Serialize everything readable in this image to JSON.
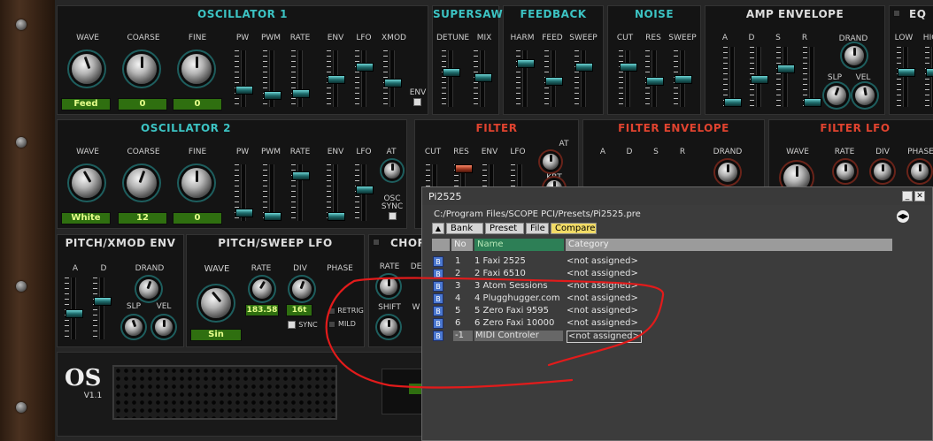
{
  "window": {
    "title": "Pi2525",
    "path": "C:/Program Files/SCOPE PCI/Presets/Pi2525.pre",
    "minimize_label": "_",
    "close_label": "✕",
    "nav_icon": "◀▶"
  },
  "tabs": [
    {
      "label": "Bank"
    },
    {
      "label": "Preset"
    },
    {
      "label": "File"
    },
    {
      "label": "Compare"
    }
  ],
  "scroll_up_label": "▲",
  "columns": {
    "no": "No",
    "name": "Name",
    "category": "Category"
  },
  "presets": [
    {
      "no": "1",
      "name": "1 Faxi 2525",
      "category": "<not assigned>"
    },
    {
      "no": "2",
      "name": "2 Faxi 6510",
      "category": "<not assigned>"
    },
    {
      "no": "3",
      "name": "3 Atom Sessions",
      "category": "<not assigned>"
    },
    {
      "no": "4",
      "name": "4 Plugghugger.com",
      "category": "<not assigned>"
    },
    {
      "no": "5",
      "name": "5 Zero Faxi 9595",
      "category": "<not assigned>"
    },
    {
      "no": "6",
      "name": "6 Zero Faxi 10000",
      "category": "<not assigned>"
    },
    {
      "no": "-1",
      "name": "MIDI Controler",
      "category": "<not assigned>"
    }
  ],
  "bank_badge": "B",
  "synth": {
    "osc1": {
      "title": "OSCILLATOR 1",
      "wave": "WAVE",
      "coarse": "COARSE",
      "fine": "FINE",
      "pw": "PW",
      "pwm": "PWM",
      "rate": "RATE",
      "env": "ENV",
      "lfo": "LFO",
      "xmod": "XMOD",
      "env_small": "ENV",
      "wave_val": "Feed",
      "coarse_val": "0",
      "fine_val": "0"
    },
    "supersaw": {
      "title": "SUPERSAW",
      "detune": "DETUNE",
      "mix": "MIX"
    },
    "feedback": {
      "title": "FEEDBACK",
      "harm": "HARM",
      "feed": "FEED",
      "sweep": "SWEEP"
    },
    "noise": {
      "title": "NOISE",
      "cut": "CUT",
      "res": "RES",
      "sweep": "SWEEP"
    },
    "amp_env": {
      "title": "AMP ENVELOPE",
      "a": "A",
      "d": "D",
      "s": "S",
      "r": "R",
      "drand": "DRAND",
      "slp": "SLP",
      "vel": "VEL"
    },
    "eq": {
      "title": "EQ",
      "low": "LOW",
      "high": "HIG"
    },
    "osc2": {
      "title": "OSCILLATOR 2",
      "wave": "WAVE",
      "coarse": "COARSE",
      "fine": "FINE",
      "pw": "PW",
      "pwm": "PWM",
      "rate": "RATE",
      "env": "ENV",
      "lfo": "LFO",
      "at": "AT",
      "osc": "OSC",
      "sync": "SYNC",
      "wave_val": "White",
      "coarse_val": "12",
      "fine_val": "0"
    },
    "filter": {
      "title": "FILTER",
      "cut": "CUT",
      "res": "RES",
      "env": "ENV",
      "lfo": "LFO",
      "at": "AT",
      "kbt": "KBT"
    },
    "filter_env": {
      "title": "FILTER ENVELOPE",
      "a": "A",
      "d": "D",
      "s": "S",
      "r": "R",
      "drand": "DRAND"
    },
    "filter_lfo": {
      "title": "FILTER LFO",
      "wave": "WAVE",
      "rate": "RATE",
      "div": "DIV",
      "phase": "PHASE"
    },
    "pitch_env": {
      "title": "PITCH/XMOD ENV",
      "a": "A",
      "d": "D",
      "drand": "DRAND",
      "slp": "SLP",
      "vel": "VEL"
    },
    "pitch_lfo": {
      "title": "PITCH/SWEEP LFO",
      "wave": "WAVE",
      "rate": "RATE",
      "div": "DIV",
      "phase": "PHASE",
      "rate_val": "183.58",
      "div_val": "16t",
      "retrig": "RETRIG",
      "mild": "MILD",
      "sync": "SYNC",
      "wave_val": "Sin"
    },
    "chorus": {
      "title": "CHOR",
      "rate": "RATE",
      "de": "DE",
      "shift": "SHIFT",
      "w": "W"
    },
    "logo": {
      "text": "OS",
      "version": "V1.1"
    }
  },
  "colors": {
    "teal": "#3cc3c3",
    "red": "#e0432f",
    "display_bg": "#2f6f10",
    "display_text": "#e6ff8a",
    "annotation": "#e21b1b",
    "name_header": "#2d7f56",
    "compare_tab": "#f1db66",
    "badge": "#4b78d0"
  }
}
